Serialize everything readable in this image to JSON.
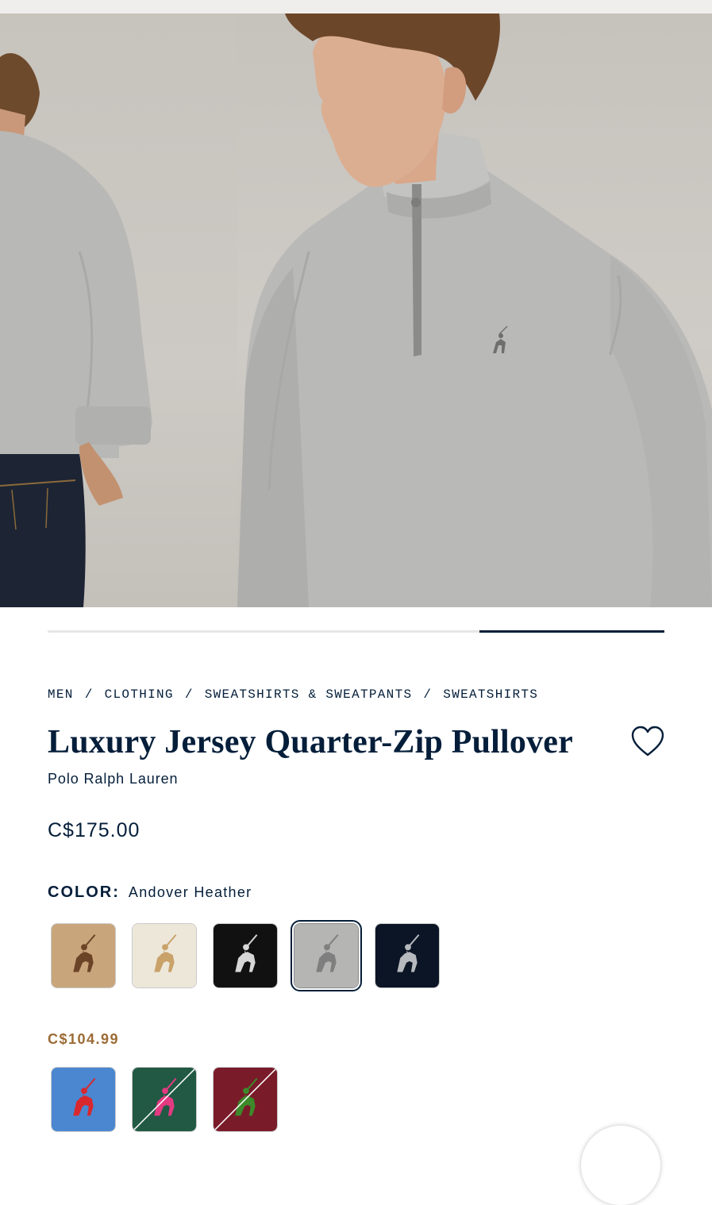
{
  "gallery": {
    "images": [
      {
        "alt": "Back view of man wearing grey quarter-zip pullover"
      },
      {
        "alt": "Man wearing grey quarter-zip pullover"
      }
    ],
    "progress": 0.3
  },
  "breadcrumb": {
    "items": [
      "MEN",
      "CLOTHING",
      "SWEATSHIRTS & SWEATPANTS",
      "SWEATSHIRTS"
    ],
    "separator": "/"
  },
  "product": {
    "title": "Luxury Jersey Quarter-Zip Pullover",
    "brand": "Polo Ralph Lauren",
    "price": "C$175.00",
    "wishlist_icon": "heart-icon"
  },
  "color": {
    "label": "COLOR:",
    "selected": "Andover Heather",
    "full_price_swatches": [
      {
        "name": "Tan",
        "bg": "#c9a57c",
        "logo": "#6b4427"
      },
      {
        "name": "Cream",
        "bg": "#ede7da",
        "logo": "#c9a26a"
      },
      {
        "name": "Black",
        "bg": "#111111",
        "logo": "#d7d7d7"
      },
      {
        "name": "Andover Heather",
        "bg": "#b5b6b4",
        "logo": "#7e7f7e",
        "selected": true
      },
      {
        "name": "Navy",
        "bg": "#0c1526",
        "logo": "#b6b9be"
      }
    ],
    "sale_price": "C$104.99",
    "sale_swatches": [
      {
        "name": "Blue",
        "bg": "#4a87d0",
        "logo": "#d8282e"
      },
      {
        "name": "Green",
        "bg": "#215944",
        "logo": "#e33a82",
        "unavailable": true
      },
      {
        "name": "Burgundy",
        "bg": "#7a1b2a",
        "logo": "#3c8a2a",
        "unavailable": true
      }
    ]
  },
  "colors": {
    "navy": "#041e3a",
    "sale": "#9c6b35"
  }
}
